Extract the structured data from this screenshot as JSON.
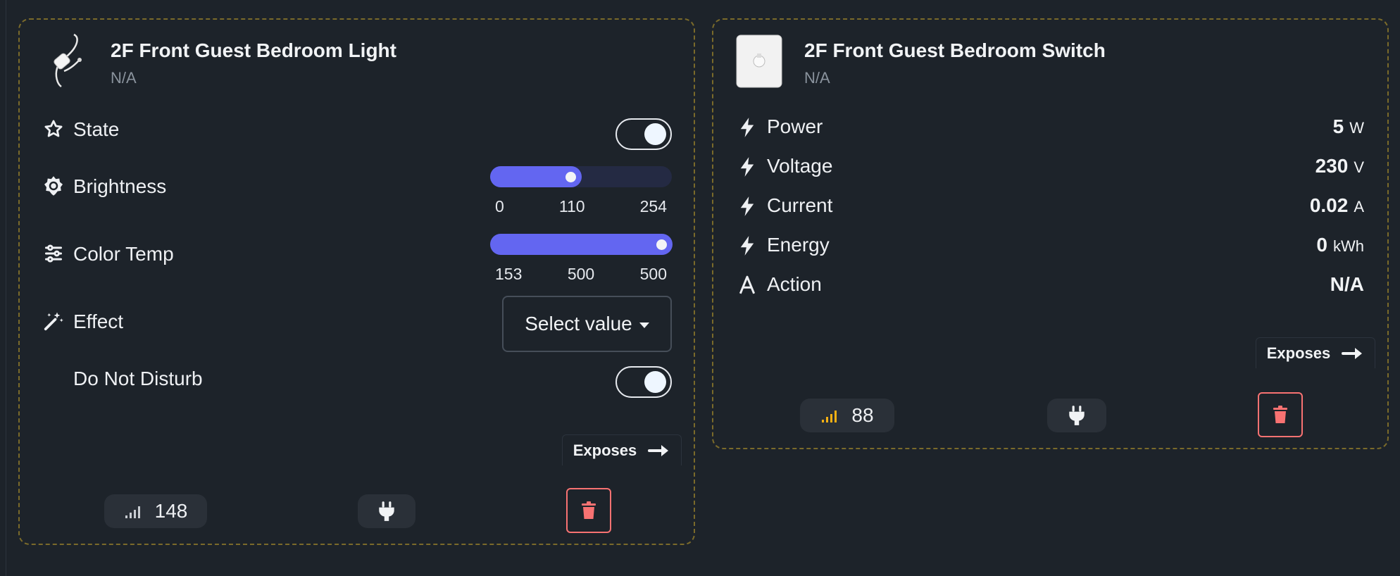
{
  "colors": {
    "accent": "#6366f1",
    "danger": "#f87272",
    "border": "#7a6a2a",
    "lqi_good": "#f5b014"
  },
  "light_card": {
    "name": "2F Front Guest Bedroom Light",
    "subtitle": "N/A",
    "rows": {
      "state": {
        "label": "State",
        "icon": "star-icon",
        "on": true
      },
      "brightness": {
        "label": "Brightness",
        "icon": "brightness-icon",
        "min": "0",
        "value": "110",
        "max": "254",
        "fraction": 0.433
      },
      "color_temp": {
        "label": "Color Temp",
        "icon": "sliders-icon",
        "min": "153",
        "value": "500",
        "max": "500",
        "fraction": 1.0
      },
      "effect": {
        "label": "Effect",
        "icon": "magic-wand-icon",
        "select_value": "Select value"
      },
      "dnd": {
        "label": "Do Not Disturb",
        "on": true
      }
    },
    "exposes_label": "Exposes",
    "lqi": "148",
    "icons": {
      "signal": "signal-icon",
      "power": "plug-icon",
      "delete": "trash-icon"
    }
  },
  "switch_card": {
    "name": "2F Front Guest Bedroom Switch",
    "subtitle": "N/A",
    "metrics": [
      {
        "label": "Power",
        "icon": "bolt-icon",
        "value": "5",
        "unit": "W"
      },
      {
        "label": "Voltage",
        "icon": "bolt-icon",
        "value": "230",
        "unit": "V"
      },
      {
        "label": "Current",
        "icon": "bolt-icon",
        "value": "0.02",
        "unit": "A"
      },
      {
        "label": "Energy",
        "icon": "bolt-icon",
        "value": "0",
        "unit": "kWh"
      },
      {
        "label": "Action",
        "icon": "letter-a-icon",
        "value": "N/A",
        "unit": ""
      }
    ],
    "exposes_label": "Exposes",
    "lqi": "88",
    "icons": {
      "signal": "signal-icon",
      "power": "plug-icon",
      "delete": "trash-icon"
    }
  }
}
